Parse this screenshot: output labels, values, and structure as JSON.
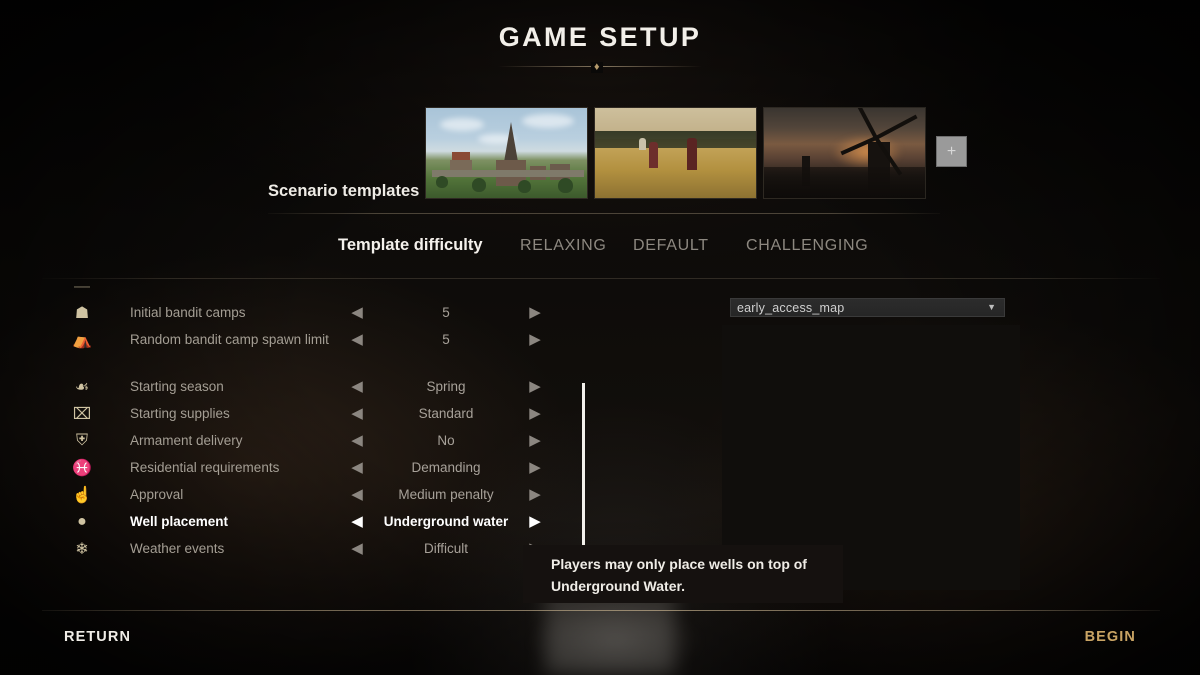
{
  "title": "GAME SETUP",
  "templates": {
    "label": "Scenario templates",
    "items": [
      {
        "name": "village-template",
        "alt": "Medieval village with church spire"
      },
      {
        "name": "harvest-template",
        "alt": "Wheat field with harvesters"
      },
      {
        "name": "windmill-template",
        "alt": "Windmill at dusk"
      }
    ],
    "add_label": "+"
  },
  "difficulty": {
    "label": "Template difficulty",
    "tabs": [
      {
        "label": "RELAXING",
        "selected": false
      },
      {
        "label": "DEFAULT",
        "selected": false
      },
      {
        "label": "CHALLENGING",
        "selected": false
      }
    ]
  },
  "settings": {
    "arrow_left": "◀",
    "arrow_right": "▶",
    "rows": [
      {
        "icon": "dash-icon",
        "glyph": "—",
        "label": "",
        "value": "",
        "active": false,
        "clipped": true
      },
      {
        "icon": "campfire-icon",
        "glyph": "☗",
        "label": "Initial bandit camps",
        "value": "5",
        "active": false,
        "clipped": false
      },
      {
        "icon": "tent-icon",
        "glyph": "⛺",
        "label": "Random bandit camp spawn limit",
        "value": "5",
        "active": false,
        "clipped": false
      },
      {
        "icon": "sprout-icon",
        "glyph": "☙",
        "label": "Starting season",
        "value": "Spring",
        "active": false,
        "clipped": false
      },
      {
        "icon": "crate-icon",
        "glyph": "⌧",
        "label": "Starting supplies",
        "value": "Standard",
        "active": false,
        "clipped": false
      },
      {
        "icon": "shield-icon",
        "glyph": "⛨",
        "label": "Armament delivery",
        "value": "No",
        "active": false,
        "clipped": false
      },
      {
        "icon": "medal-icon",
        "glyph": "♓",
        "label": "Residential requirements",
        "value": "Demanding",
        "active": false,
        "clipped": false
      },
      {
        "icon": "thumbs-up-icon",
        "glyph": "☝",
        "label": "Approval",
        "value": "Medium penalty",
        "active": false,
        "clipped": false
      },
      {
        "icon": "water-drop-icon",
        "glyph": "●",
        "label": "Well placement",
        "value": "Underground water",
        "active": true,
        "clipped": false
      },
      {
        "icon": "weather-icon",
        "glyph": "❄",
        "label": "Weather events",
        "value": "Difficult",
        "active": false,
        "clipped": false
      }
    ]
  },
  "map": {
    "selected": "early_access_map",
    "caret": "▼"
  },
  "tooltip": {
    "line1": "Players may only place wells on top of",
    "line2": "Underground Water."
  },
  "footer": {
    "return_label": "RETURN",
    "begin_label": "BEGIN"
  },
  "colors": {
    "accent_gold": "#c9a464",
    "text_primary": "#f0ede7",
    "text_muted": "#a49e94",
    "background": "#0a0908"
  }
}
